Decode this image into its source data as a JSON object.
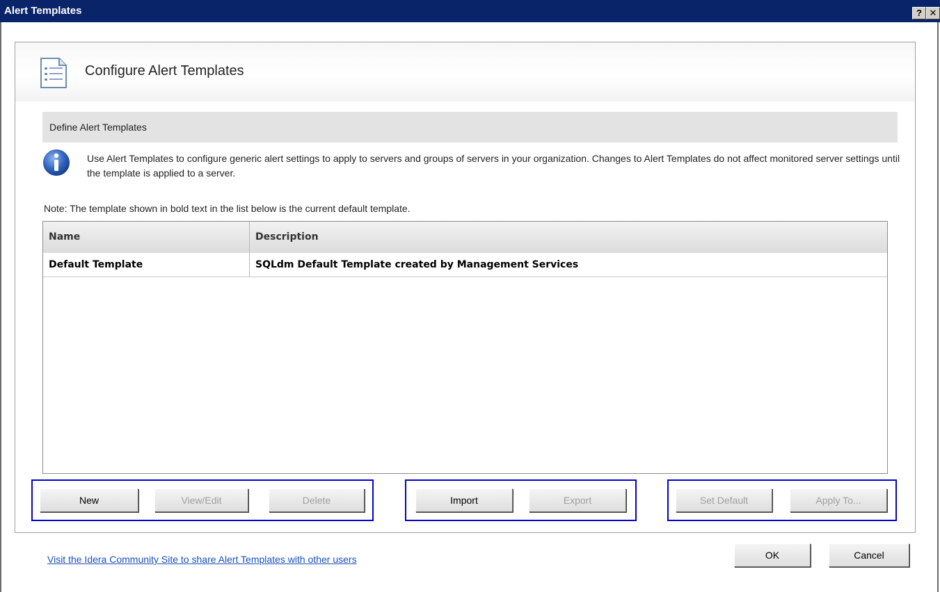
{
  "window": {
    "title": "Alert Templates",
    "help_label": "?",
    "close_label": "✕"
  },
  "header": {
    "title": "Configure Alert Templates",
    "icon": "document-list-icon"
  },
  "section": {
    "label": "Define Alert Templates",
    "info_icon": "info-icon",
    "info_text": "Use Alert Templates to configure generic alert settings to apply to servers and groups of servers in your organization.  Changes to Alert Templates do not affect monitored server settings until the template is applied to a server."
  },
  "note": "Note:  The template shown in bold text in the list below is the current default template.",
  "table": {
    "columns": [
      "Name",
      "Description"
    ],
    "rows": [
      {
        "name": "Default Template",
        "description": "SQLdm Default Template created by Management Services",
        "bold": true
      }
    ]
  },
  "buttons": {
    "new": "New",
    "view_edit": "View/Edit",
    "delete": "Delete",
    "import": "Import",
    "export": "Export",
    "set_default": "Set Default",
    "apply_to": "Apply To...",
    "ok": "OK",
    "cancel": "Cancel"
  },
  "footer": {
    "link_text": "Visit the Idera Community Site to share Alert Templates with other users"
  },
  "colors": {
    "titlebar": "#0a246a",
    "highlight_box": "#0000cc",
    "link": "#1a4fbf"
  }
}
